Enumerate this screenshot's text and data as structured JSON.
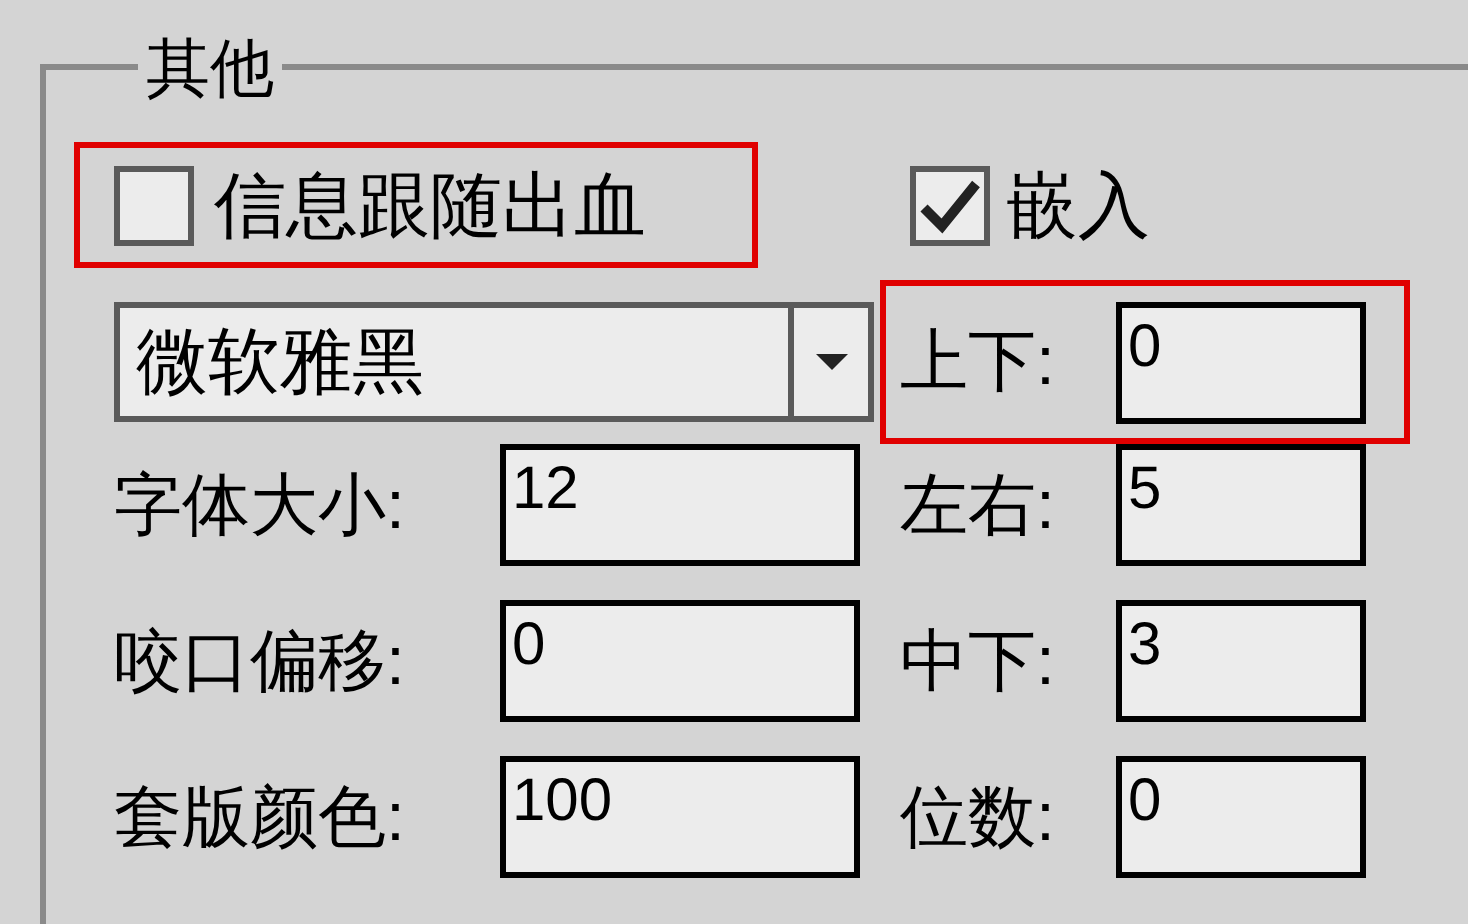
{
  "group": {
    "title": "其他"
  },
  "checkboxes": [
    {
      "label": "信息跟随出血",
      "checked": false,
      "highlighted": true
    },
    {
      "label": "嵌入",
      "checked": true,
      "highlighted": false
    }
  ],
  "font_dropdown": {
    "value": "微软雅黑"
  },
  "left_fields": [
    {
      "label": "字体大小:",
      "value": "12"
    },
    {
      "label": "咬口偏移:",
      "value": "0"
    },
    {
      "label": "套版颜色:",
      "value": "100"
    }
  ],
  "right_fields": [
    {
      "label": "上下:",
      "value": "0",
      "highlighted": true
    },
    {
      "label": "左右:",
      "value": "5",
      "highlighted": false
    },
    {
      "label": "中下:",
      "value": "3",
      "highlighted": false
    },
    {
      "label": "位数:",
      "value": "0",
      "highlighted": false
    }
  ]
}
